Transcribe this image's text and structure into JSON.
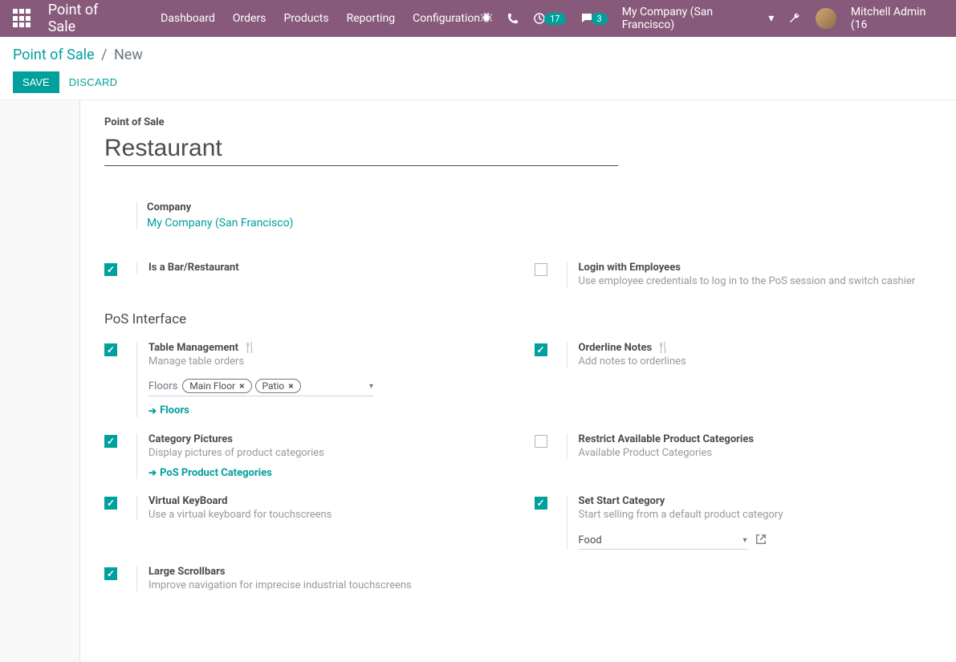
{
  "topbar": {
    "app_title": "Point of Sale",
    "nav": [
      "Dashboard",
      "Orders",
      "Products",
      "Reporting",
      "Configuration"
    ],
    "badge_clock": "17",
    "badge_chat": "3",
    "company": "My Company (San Francisco)",
    "user": "Mitchell Admin (16"
  },
  "breadcrumb": {
    "root": "Point of Sale",
    "current": "New"
  },
  "actions": {
    "save": "SAVE",
    "discard": "DISCARD"
  },
  "form": {
    "label": "Point of Sale",
    "name": "Restaurant",
    "company_label": "Company",
    "company_value": "My Company (San Francisco)"
  },
  "sections": {
    "pos_interface": "PoS Interface"
  },
  "settings": {
    "is_bar": {
      "title": "Is a Bar/Restaurant",
      "checked": true
    },
    "login_emp": {
      "title": "Login with Employees",
      "desc": "Use employee credentials to log in to the PoS session and switch cashier",
      "checked": false
    },
    "table_mgmt": {
      "title": "Table Management",
      "desc": "Manage table orders",
      "checked": true,
      "floors_label": "Floors",
      "tags": [
        "Main Floor",
        "Patio"
      ],
      "link": "Floors"
    },
    "orderline_notes": {
      "title": "Orderline Notes",
      "desc": "Add notes to orderlines",
      "checked": true
    },
    "cat_pictures": {
      "title": "Category Pictures",
      "desc": "Display pictures of product categories",
      "checked": true,
      "link": "PoS Product Categories"
    },
    "restrict_cat": {
      "title": "Restrict Available Product Categories",
      "desc": "Available Product Categories",
      "checked": false
    },
    "virtual_kb": {
      "title": "Virtual KeyBoard",
      "desc": "Use a virtual keyboard for touchscreens",
      "checked": true
    },
    "start_cat": {
      "title": "Set Start Category",
      "desc": "Start selling from a default product category",
      "checked": true,
      "value": "Food"
    },
    "large_scroll": {
      "title": "Large Scrollbars",
      "desc": "Improve navigation for imprecise industrial touchscreens",
      "checked": true
    }
  }
}
